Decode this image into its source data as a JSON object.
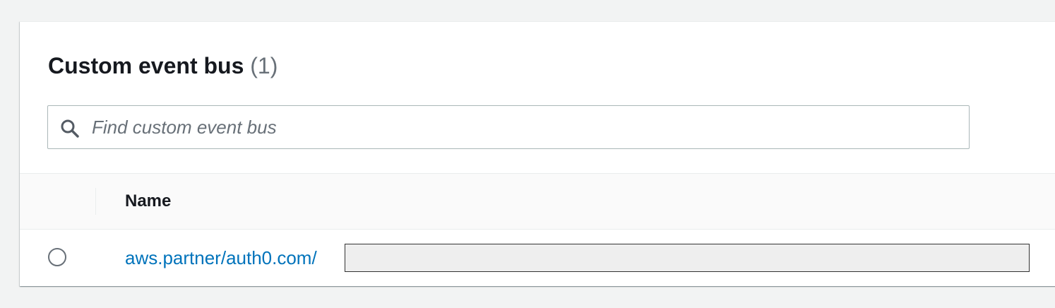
{
  "panel": {
    "title": "Custom event bus",
    "count": "(1)"
  },
  "search": {
    "placeholder": "Find custom event bus",
    "value": "",
    "icon": "search-icon"
  },
  "table": {
    "columns": [
      "Name"
    ],
    "rows": [
      {
        "name": "aws.partner/auth0.com/",
        "selected": false
      }
    ]
  },
  "colors": {
    "link": "#0073bb",
    "background": "#f2f3f3"
  }
}
